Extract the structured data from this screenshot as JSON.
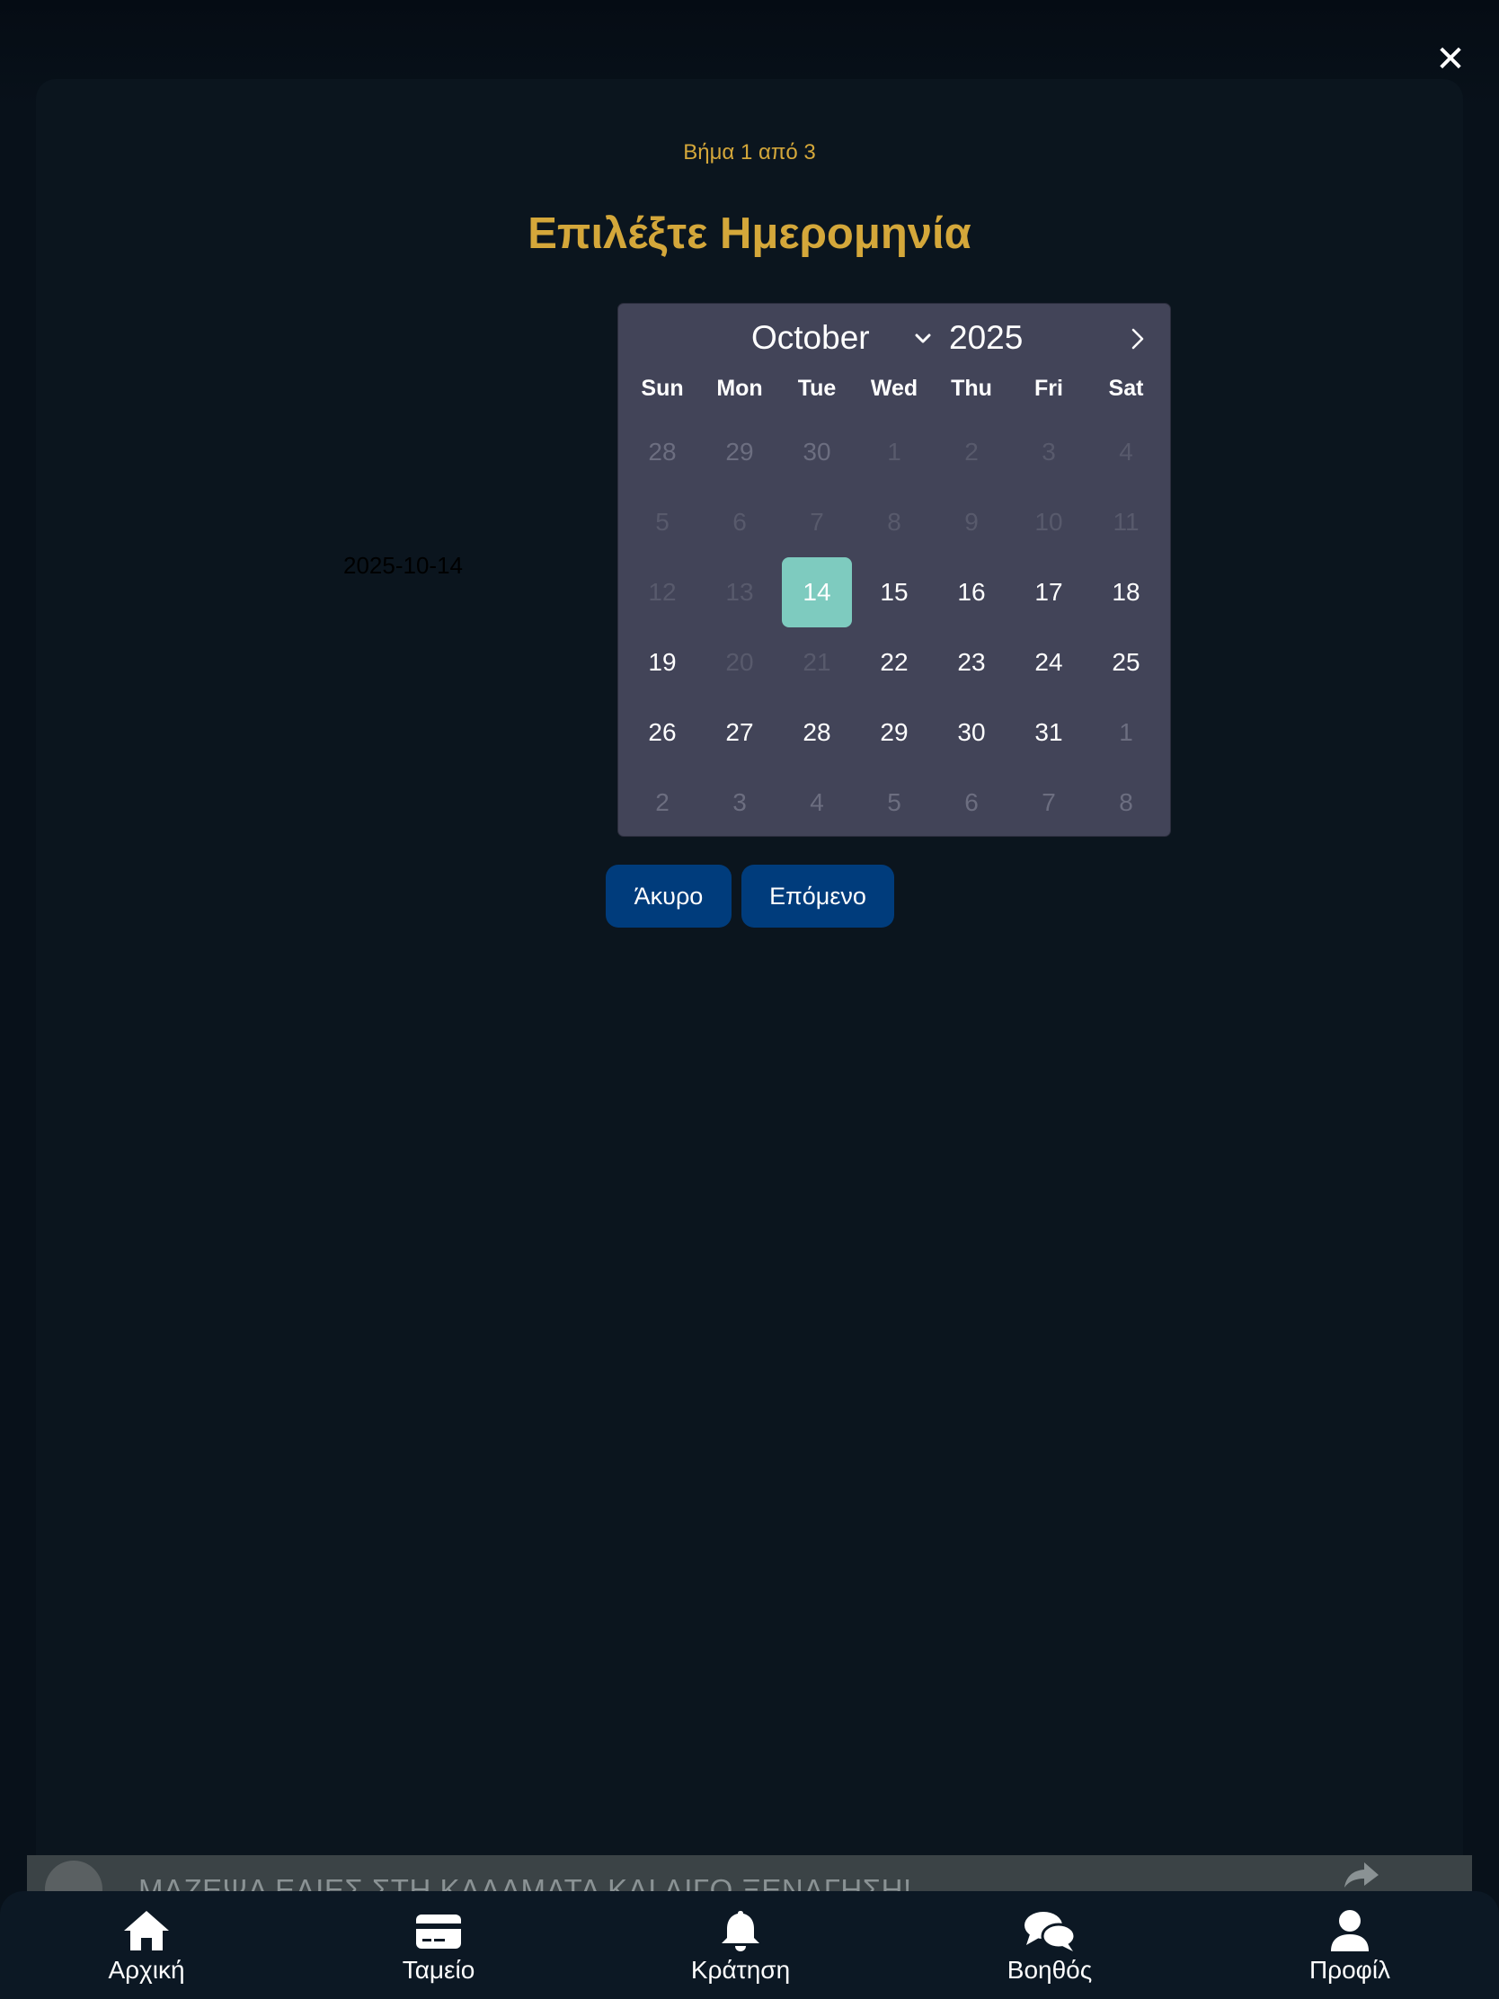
{
  "close_icon": "close-icon",
  "step_label": "Βήμα 1 από 3",
  "title": "Επιλέξτε Ημερομηνία",
  "date_value": "2025-10-14",
  "calendar": {
    "month": "October",
    "year": "2025",
    "weekdays": [
      "Sun",
      "Mon",
      "Tue",
      "Wed",
      "Thu",
      "Fri",
      "Sat"
    ],
    "days": [
      {
        "label": "28",
        "state": "muted"
      },
      {
        "label": "29",
        "state": "muted"
      },
      {
        "label": "30",
        "state": "muted"
      },
      {
        "label": "1",
        "state": "disabled"
      },
      {
        "label": "2",
        "state": "disabled"
      },
      {
        "label": "3",
        "state": "disabled"
      },
      {
        "label": "4",
        "state": "disabled"
      },
      {
        "label": "5",
        "state": "disabled"
      },
      {
        "label": "6",
        "state": "disabled"
      },
      {
        "label": "7",
        "state": "disabled"
      },
      {
        "label": "8",
        "state": "disabled"
      },
      {
        "label": "9",
        "state": "disabled"
      },
      {
        "label": "10",
        "state": "disabled"
      },
      {
        "label": "11",
        "state": "disabled"
      },
      {
        "label": "12",
        "state": "disabled"
      },
      {
        "label": "13",
        "state": "disabled"
      },
      {
        "label": "14",
        "state": "selected"
      },
      {
        "label": "15",
        "state": "normal"
      },
      {
        "label": "16",
        "state": "normal"
      },
      {
        "label": "17",
        "state": "normal"
      },
      {
        "label": "18",
        "state": "normal"
      },
      {
        "label": "19",
        "state": "normal"
      },
      {
        "label": "20",
        "state": "disabled"
      },
      {
        "label": "21",
        "state": "disabled"
      },
      {
        "label": "22",
        "state": "normal"
      },
      {
        "label": "23",
        "state": "normal"
      },
      {
        "label": "24",
        "state": "normal"
      },
      {
        "label": "25",
        "state": "normal"
      },
      {
        "label": "26",
        "state": "normal"
      },
      {
        "label": "27",
        "state": "normal"
      },
      {
        "label": "28",
        "state": "normal"
      },
      {
        "label": "29",
        "state": "normal"
      },
      {
        "label": "30",
        "state": "normal"
      },
      {
        "label": "31",
        "state": "normal"
      },
      {
        "label": "1",
        "state": "muted"
      },
      {
        "label": "2",
        "state": "muted"
      },
      {
        "label": "3",
        "state": "muted"
      },
      {
        "label": "4",
        "state": "muted"
      },
      {
        "label": "5",
        "state": "muted"
      },
      {
        "label": "6",
        "state": "muted"
      },
      {
        "label": "7",
        "state": "muted"
      },
      {
        "label": "8",
        "state": "muted"
      }
    ]
  },
  "buttons": {
    "cancel": "Άκυρο",
    "next": "Επόμενο"
  },
  "banner": {
    "text": "ΜΑΖΕΨΑ ΕΛΙΕΣ ΣΤΗ ΚΑΛΑΜΑΤΑ ΚΑΙ ΛΙΓΟ ΞΕΝΑΓΗΣΗ!"
  },
  "bottom_nav": [
    {
      "label": "Αρχική",
      "icon": "home-icon"
    },
    {
      "label": "Ταμείο",
      "icon": "credit-card-icon"
    },
    {
      "label": "Κράτηση",
      "icon": "bell-icon"
    },
    {
      "label": "Βοηθός",
      "icon": "chat-icon"
    },
    {
      "label": "Προφίλ",
      "icon": "user-icon"
    }
  ],
  "colors": {
    "accent_gold": "#d4a73a",
    "button_blue": "#003c7c",
    "selected_day": "#7ecbbf",
    "calendar_bg": "#424458"
  }
}
